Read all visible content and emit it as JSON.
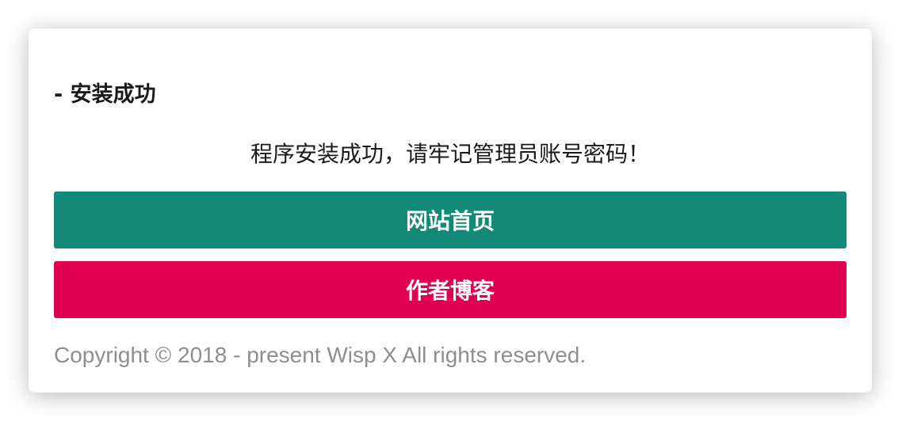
{
  "header": {
    "title": "- 安装成功"
  },
  "main": {
    "message": "程序安装成功，请牢记管理员账号密码！",
    "buttons": {
      "home_label": "网站首页",
      "blog_label": "作者博客"
    }
  },
  "footer": {
    "copyright": "Copyright © 2018 - present Wisp X All rights reserved."
  },
  "colors": {
    "home_button": "#138a77",
    "blog_button": "#e0004f",
    "footer_text": "#8e8e8e"
  }
}
